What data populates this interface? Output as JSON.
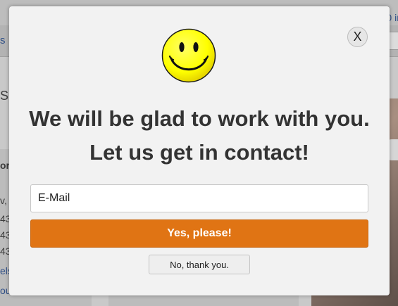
{
  "background": {
    "nav_fragment": "s",
    "top_right_fragment": "0 in",
    "heading_fragment": "S",
    "left_col": {
      "bold_fragment": "or",
      "lines": [
        "v,",
        "43",
        "43",
        "43"
      ],
      "links": [
        "els",
        "ou"
      ]
    }
  },
  "modal": {
    "close_label": "X",
    "icon": "smiley-face-icon",
    "headline": "We will be glad to work with you. Let us get in contact!",
    "email": {
      "value": "",
      "placeholder": "E-Mail"
    },
    "accept_label": "Yes, please!",
    "decline_label": "No, thank you."
  },
  "colors": {
    "accent": "#e07414",
    "smiley_yellow": "#ffff00",
    "headline_text": "#333333",
    "modal_bg": "#f2f2f2"
  }
}
